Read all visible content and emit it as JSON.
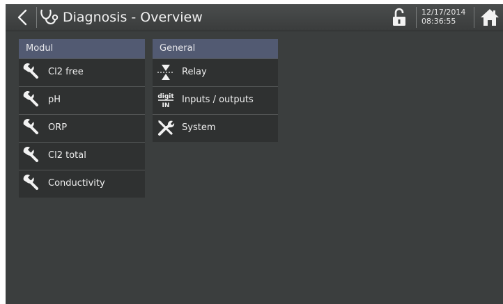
{
  "header": {
    "title": "Diagnosis - Overview",
    "date": "12/17/2014",
    "time": "08:36:55",
    "icons": [
      "back-arrow-icon",
      "stethoscope-icon",
      "unlocked-padlock-icon",
      "home-icon"
    ]
  },
  "modul": {
    "heading": "Modul",
    "items": [
      {
        "label": "Cl2 free",
        "icon": "wrench-icon"
      },
      {
        "label": "pH",
        "icon": "wrench-icon"
      },
      {
        "label": "ORP",
        "icon": "wrench-icon"
      },
      {
        "label": "Cl2 total",
        "icon": "wrench-icon"
      },
      {
        "label": "Conductivity",
        "icon": "wrench-icon"
      }
    ]
  },
  "general": {
    "heading": "General",
    "items": [
      {
        "label": "Relay",
        "icon": "relay-icon"
      },
      {
        "label": "Inputs / outputs",
        "icon": "digit-in-icon",
        "icon_text_top": "digit",
        "icon_text_bottom": "IN"
      },
      {
        "label": "System",
        "icon": "wrench-screwdriver-icon"
      }
    ]
  },
  "colors": {
    "background": "#3b3e3e",
    "heading_bar": "#525a72",
    "list_item": "#2f3131",
    "text": "#efefef"
  }
}
